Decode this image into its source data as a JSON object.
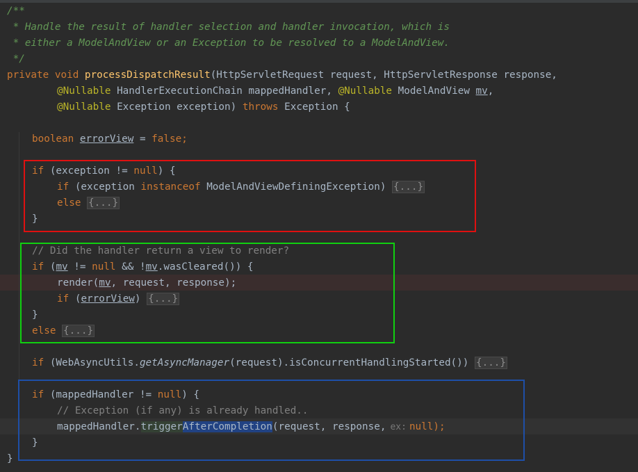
{
  "code": {
    "doc_open": "/**",
    "doc_line1": " * Handle the result of handler selection and handler invocation, which is",
    "doc_line2": " * either a ModelAndView or an Exception to be resolved to a ModelAndView.",
    "doc_close": " */",
    "sig": {
      "kw_private": "private",
      "kw_void": "void",
      "method": "processDispatchResult",
      "p_open": "(HttpServletRequest request, HttpServletResponse response,",
      "ann_nullable": "@Nullable",
      "param2": "HandlerExecutionChain mappedHandler,",
      "param3_type": "ModelAndView",
      "param3_name": "mv",
      "comma": ",",
      "param4": "Exception exception)",
      "kw_throws": "throws",
      "throws_rest": "Exception {"
    },
    "decl": {
      "kw_boolean": "boolean",
      "var": "errorView",
      "eq": " = ",
      "kw_false": "false",
      "semi": ";"
    },
    "block_red": {
      "kw_if": "if",
      "cond": " (exception != ",
      "kw_null": "null",
      "cond_end": ") {",
      "inner_if_pre": " (exception ",
      "kw_instanceof": "instanceof",
      "inner_if_post": " ModelAndViewDefiningException) ",
      "fold1": "{...}",
      "kw_else": "else",
      "fold2": "{...}",
      "close": "}"
    },
    "block_green": {
      "comment": "// Did the handler return a view to render?",
      "kw_if": "if",
      "c1": " (",
      "mv": "mv",
      "c2": " != ",
      "kw_null": "null",
      "c3": " && !",
      "c4": ".wasCleared()) {",
      "render_pre": "render(",
      "render_post": ", request, response);",
      "if_err_pre": " (",
      "errorView": "errorView",
      "if_err_post": ") ",
      "fold1": "{...}",
      "close": "}",
      "kw_else": "else",
      "fold2": "{...}"
    },
    "async_line": {
      "kw_if": "if",
      "pre": " (WebAsyncUtils.",
      "static_call": "getAsyncManager",
      "post": "(request).isConcurrentHandlingStarted()) ",
      "fold": "{...}"
    },
    "block_blue": {
      "kw_if": "if",
      "cond": " (mappedHandler != ",
      "kw_null": "null",
      "cond_end": ") {",
      "comment": "// Exception (if any) is already handled..",
      "call_obj": "mappedHandler.",
      "call_m1": "trigger",
      "call_m2": "AfterCompletion",
      "call_args": "(request, response,",
      "hint": "ex:",
      "call_end": ");",
      "close": "}"
    },
    "method_close": "}"
  },
  "colors": {
    "background": "#2b2b2b",
    "keyword": "#cc7832",
    "method": "#ffc66d",
    "annotation": "#bbb529",
    "doc_comment": "#629755",
    "comment": "#808080",
    "red_box": "#e01010",
    "green_box": "#10d010",
    "blue_box": "#1e4fa8"
  }
}
